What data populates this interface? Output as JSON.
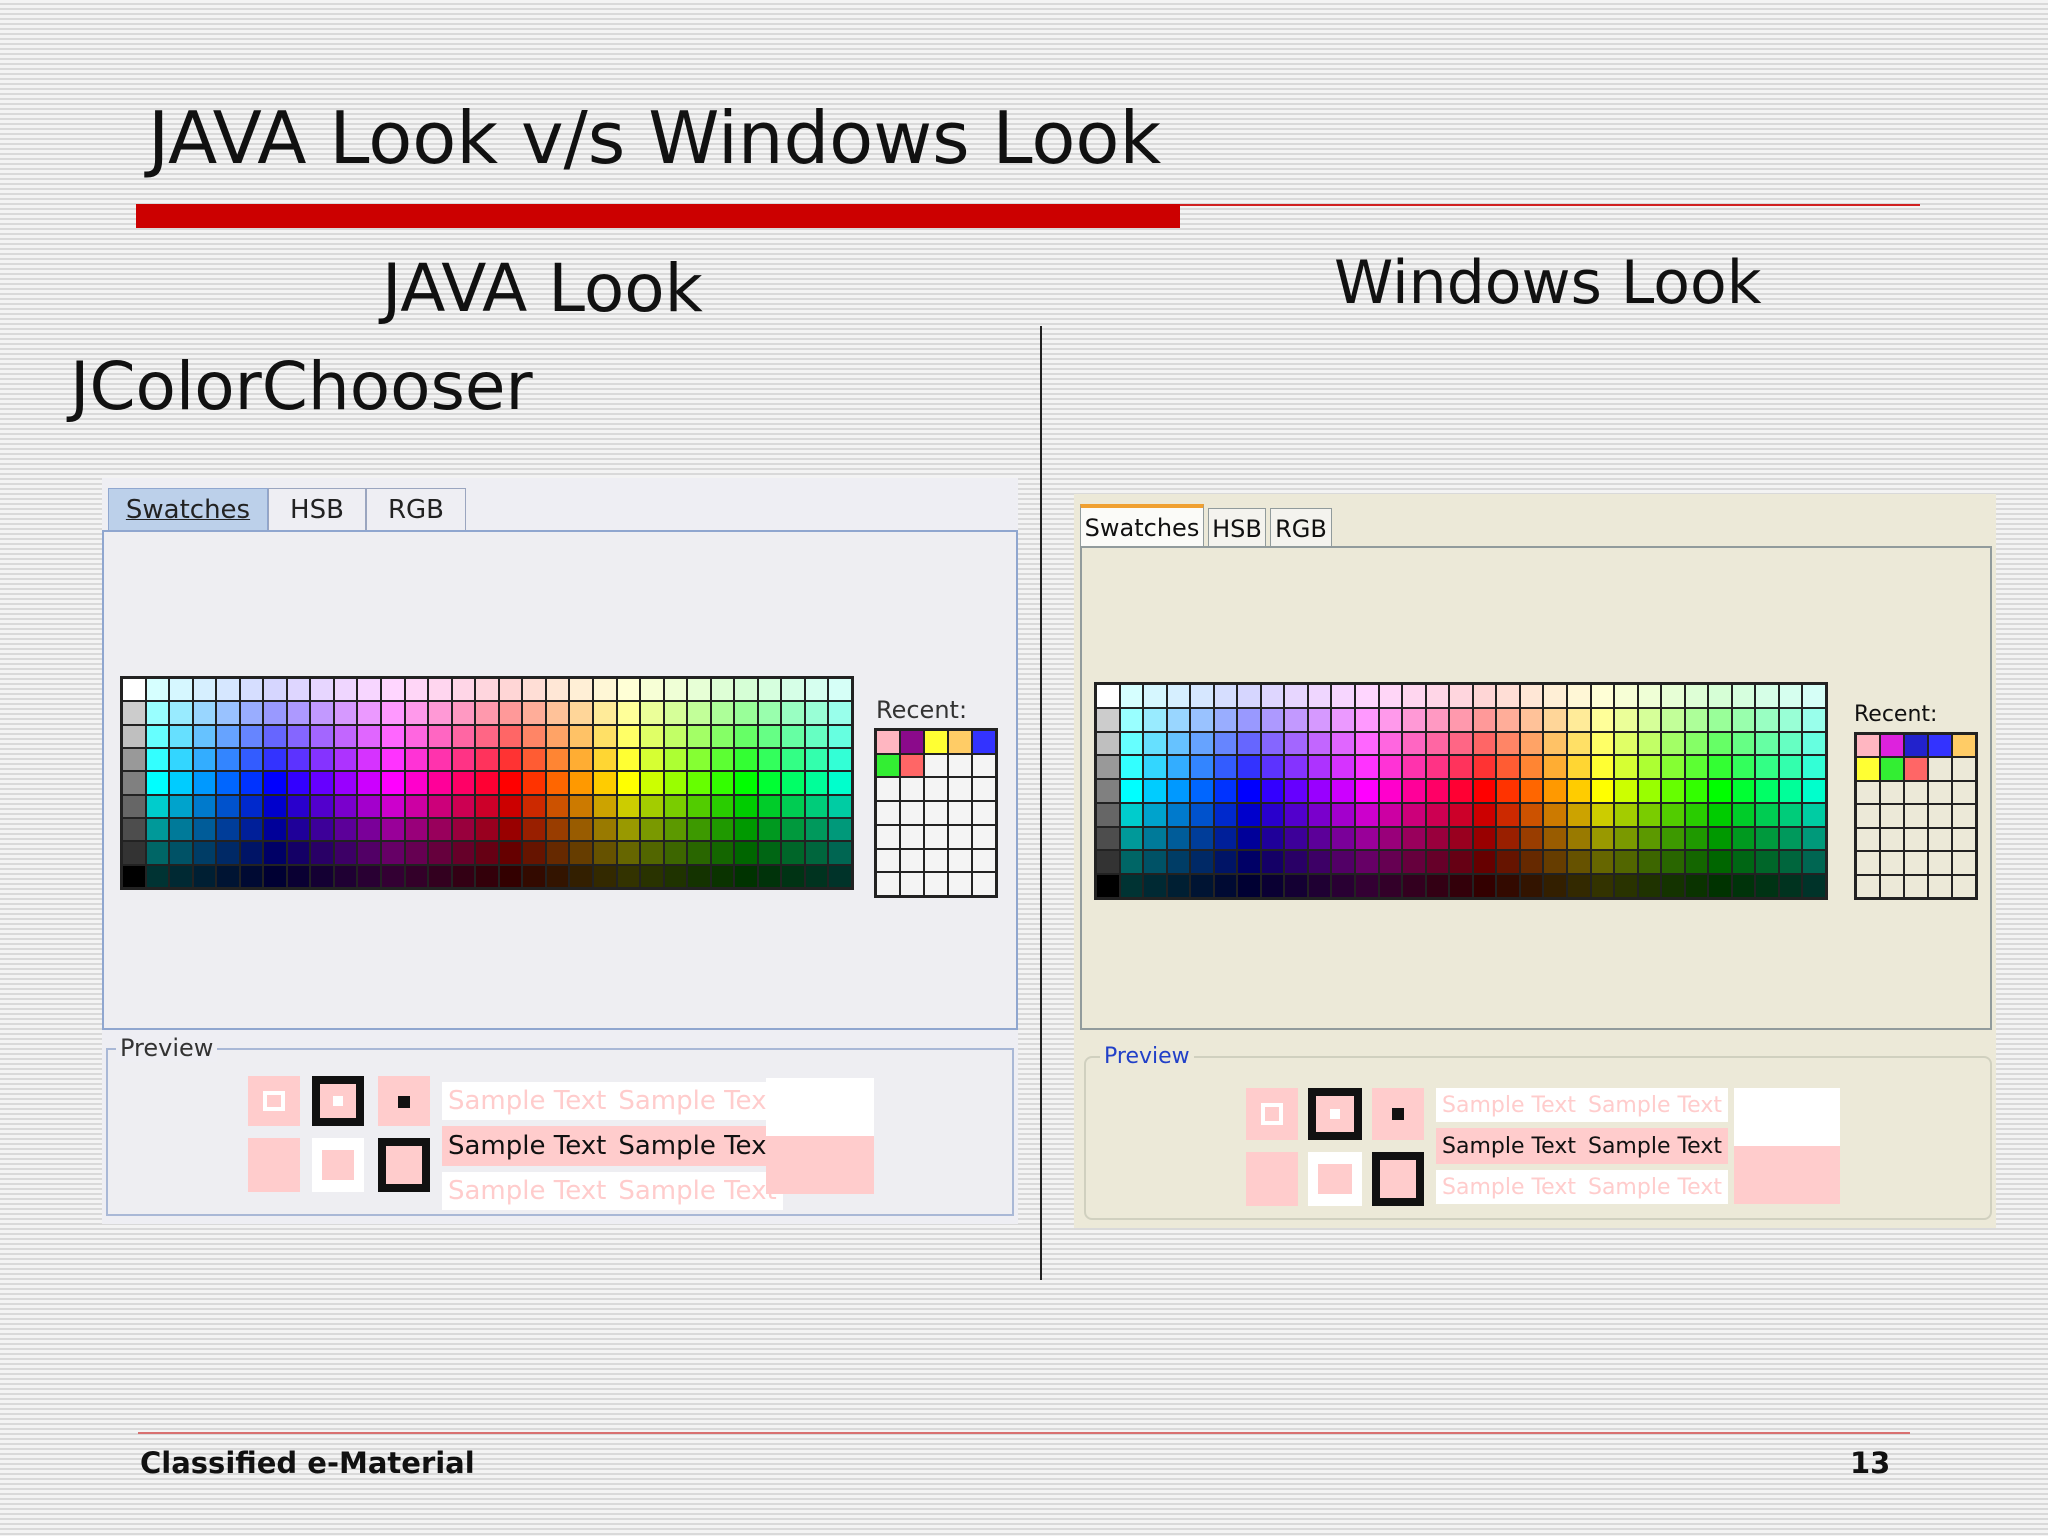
{
  "slide": {
    "title": "JAVA Look v/s Windows Look",
    "java_heading": "JAVA Look",
    "windows_heading": "Windows Look",
    "component_label": "JColorChooser",
    "footer_left": "Classified e-Material",
    "page_number": "13"
  },
  "java_chooser": {
    "tabs": [
      "Swatches",
      "HSB",
      "RGB"
    ],
    "selected_tab": "Swatches",
    "recent_label": "Recent:",
    "preview_label": "Preview",
    "sample_text": "Sample Text",
    "recent_colors": [
      "#ffb6c1",
      "#8b0a8b",
      "#ffff33",
      "#ffcc66",
      "#3333ff",
      "#33ee33",
      "#ff6666"
    ]
  },
  "windows_chooser": {
    "tabs": [
      "Swatches",
      "HSB",
      "RGB"
    ],
    "selected_tab": "Swatches",
    "recent_label": "Recent:",
    "preview_label": "Preview",
    "sample_text": "Sample Text",
    "recent_colors": [
      "#ffb6c1",
      "#dd22dd",
      "#2222cc",
      "#3333ff",
      "#ffcc66",
      "#ffff33",
      "#33ee33",
      "#ff6666"
    ]
  },
  "colors": {
    "title_bar": "#cc0000",
    "preview_pink": "#ffcccc",
    "java_tab_selected": "#bcd0ea",
    "windows_tab_accent": "#f0a030",
    "windows_preview_label": "#2140c8"
  }
}
